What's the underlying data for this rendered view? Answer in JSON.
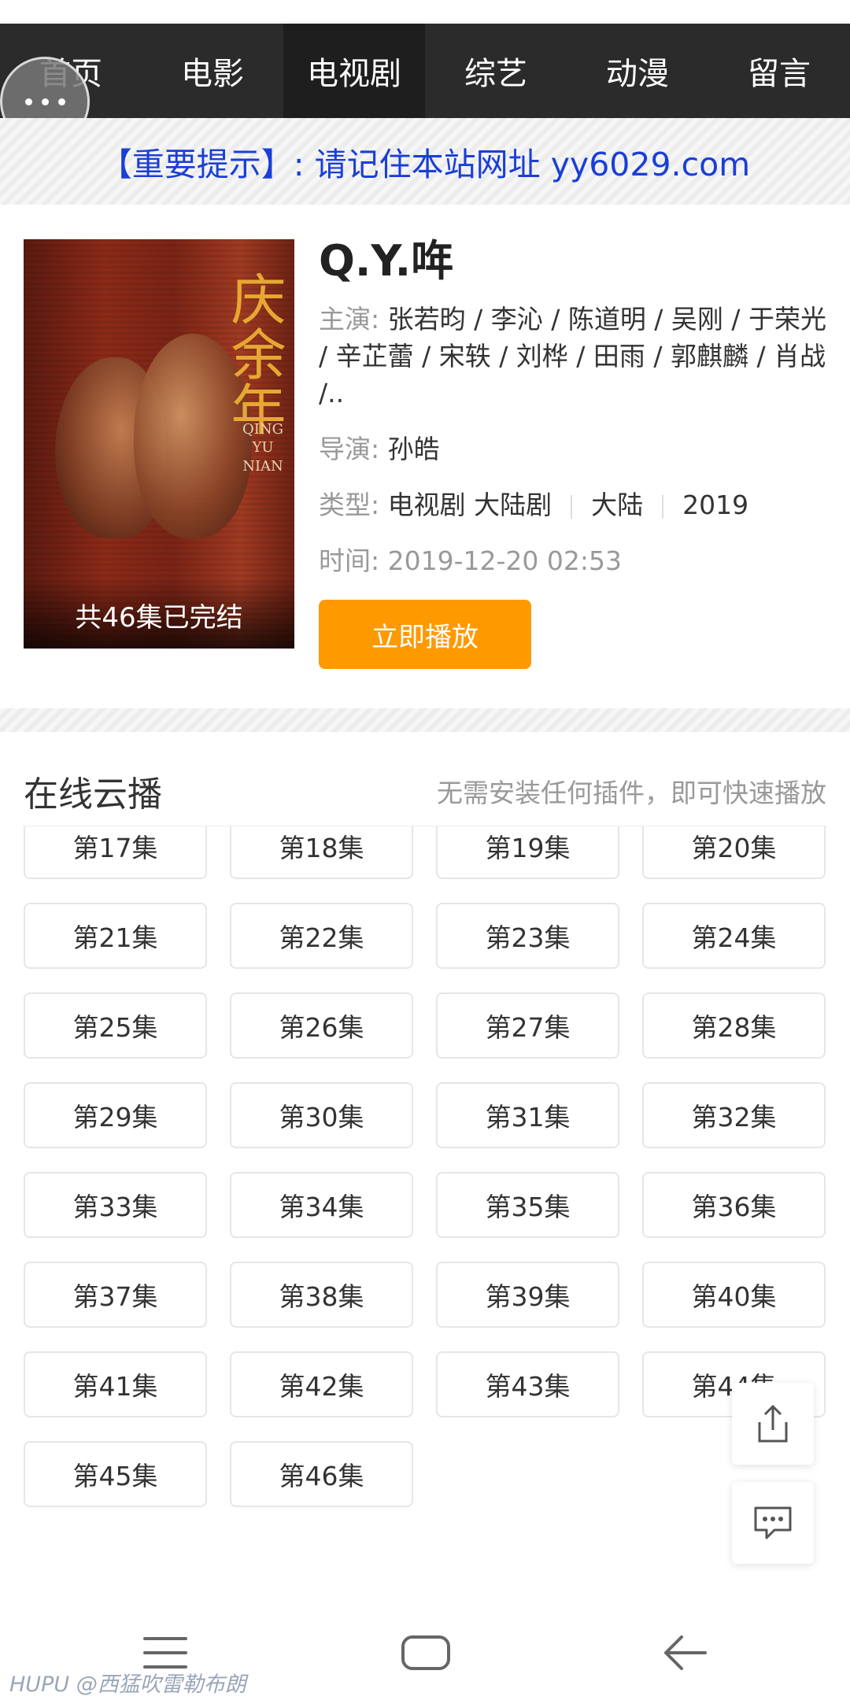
{
  "nav": {
    "items": [
      {
        "label": "首页"
      },
      {
        "label": "电影"
      },
      {
        "label": "电视剧",
        "active": true
      },
      {
        "label": "综艺"
      },
      {
        "label": "动漫"
      },
      {
        "label": "留言"
      }
    ]
  },
  "notice": "【重要提示】: 请记住本站网址 yy6029.com",
  "show": {
    "title": "Q.Y.哖",
    "poster_caption": "共46集已完结",
    "poster_calligraphy": "庆余年",
    "poster_latin": "QING\nYU\nNIAN",
    "cast_label": "主演:",
    "cast": "张若昀 / 李沁 / 陈道明 / 吴刚 / 于荣光 / 辛芷蕾 / 宋轶 / 刘桦 / 田雨 / 郭麒麟 / 肖战 /..",
    "director_label": "导演:",
    "director": "孙皓",
    "type_label": "类型:",
    "genre": "电视剧 大陆剧",
    "region": "大陆",
    "year": "2019",
    "time_label": "时间:",
    "time": "2019-12-20 02:53",
    "play_label": "立即播放"
  },
  "section": {
    "title": "在线云播",
    "tip": "无需安装任何插件，即可快速播放"
  },
  "episodes": [
    "第17集",
    "第18集",
    "第19集",
    "第20集",
    "第21集",
    "第22集",
    "第23集",
    "第24集",
    "第25集",
    "第26集",
    "第27集",
    "第28集",
    "第29集",
    "第30集",
    "第31集",
    "第32集",
    "第33集",
    "第34集",
    "第35集",
    "第36集",
    "第37集",
    "第38集",
    "第39集",
    "第40集",
    "第41集",
    "第42集",
    "第43集",
    "第44集",
    "第45集",
    "第46集"
  ],
  "icons": {
    "more": "more-icon",
    "share": "share-icon",
    "comment": "comment-icon",
    "sys_menu": "menu-icon",
    "sys_home": "home-icon",
    "sys_back": "back-icon"
  },
  "watermark": "HUPU @西猛吹雷勒布朗"
}
